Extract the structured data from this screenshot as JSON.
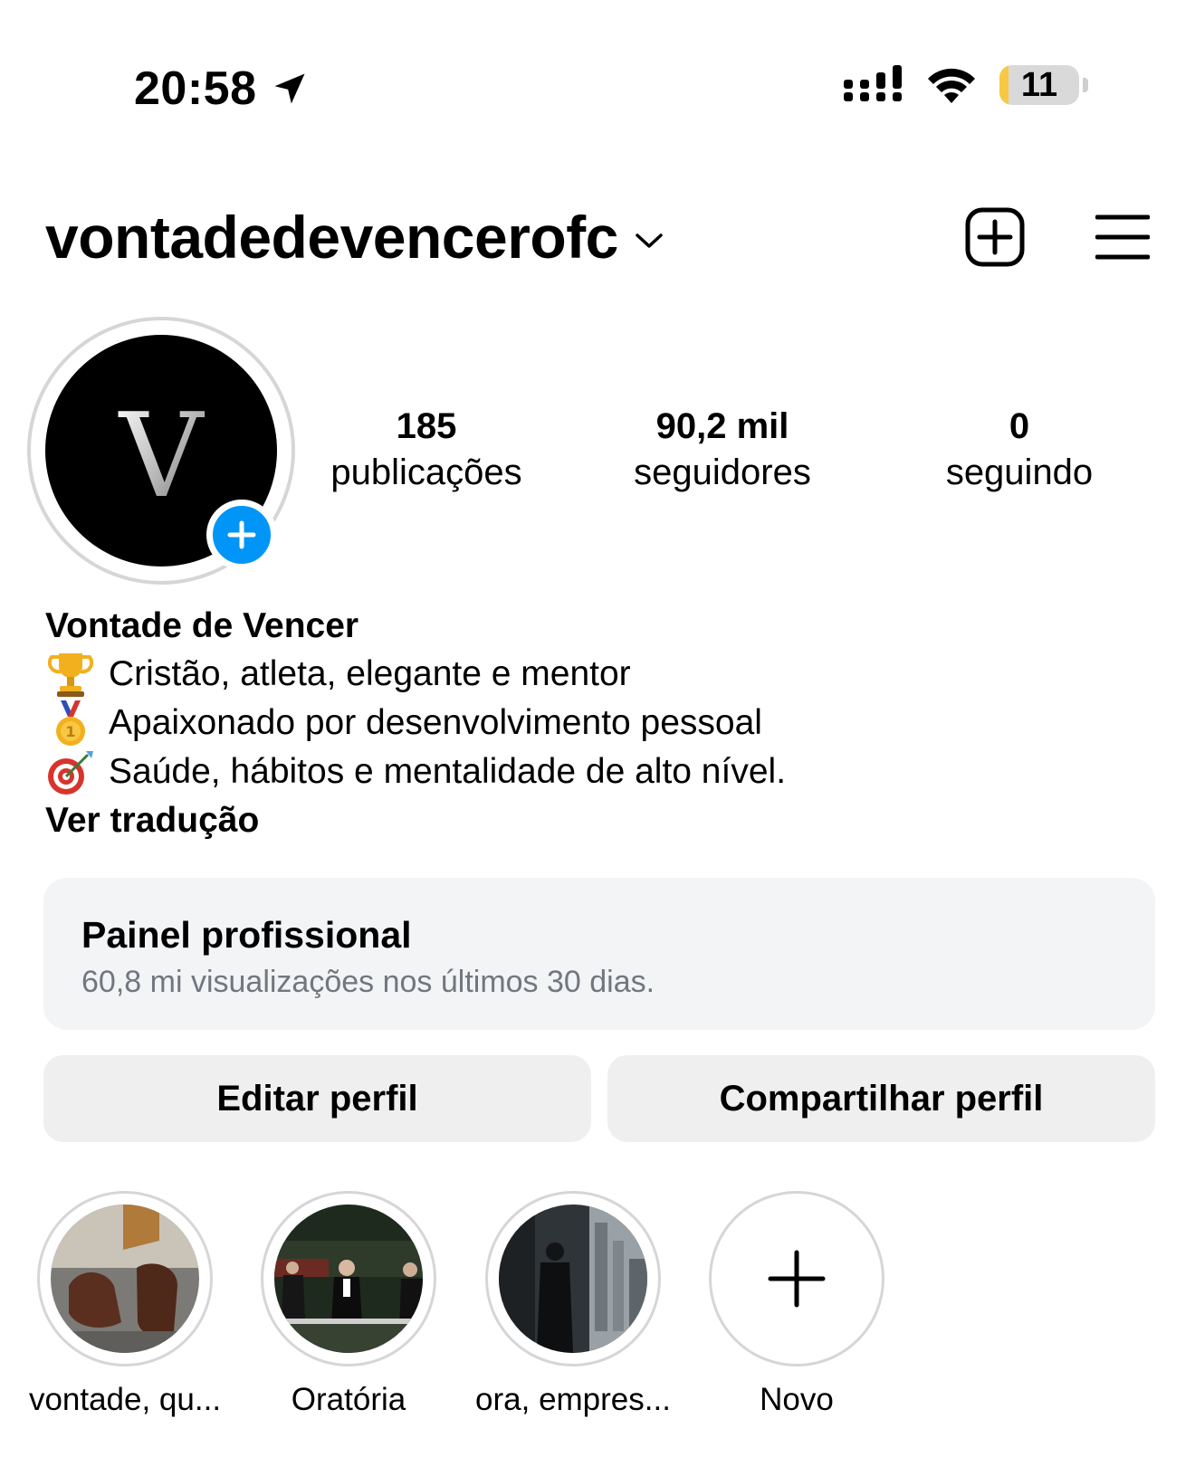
{
  "status_bar": {
    "time": "20:58",
    "battery_level": "11",
    "battery_fraction": 0.11,
    "icons": [
      "location-arrow-icon",
      "cellular-signal-icon",
      "wifi-icon",
      "battery-icon"
    ]
  },
  "header": {
    "username": "vontadedevencerofc",
    "icons": [
      "chevron-down-icon",
      "create-post-icon",
      "menu-icon"
    ]
  },
  "profile": {
    "avatar_letter": "V",
    "stats": [
      {
        "value": "185",
        "label": "publicações"
      },
      {
        "value": "90,2 mil",
        "label": "seguidores"
      },
      {
        "value": "0",
        "label": "seguindo"
      }
    ]
  },
  "bio": {
    "name": "Vontade de Vencer",
    "lines": [
      {
        "emoji": "trophy",
        "text": "Cristão, atleta, elegante e mentor"
      },
      {
        "emoji": "first-place-medal",
        "text": "Apaixonado por desenvolvimento pessoal"
      },
      {
        "emoji": "direct-hit",
        "text": "Saúde, hábitos e mentalidade de alto nível."
      }
    ],
    "translate_link": "Ver tradução"
  },
  "dashboard": {
    "title": "Painel profissional",
    "subtitle": "60,8 mi visualizações nos últimos 30 dias."
  },
  "buttons": {
    "edit": "Editar perfil",
    "share": "Compartilhar perfil"
  },
  "highlights": [
    {
      "label": "vontade, qu..."
    },
    {
      "label": "Oratória"
    },
    {
      "label": "ora, empres..."
    },
    {
      "label": "Novo"
    }
  ],
  "colors": {
    "accent_blue": "#0095f6",
    "battery_yellow": "#f7c843",
    "button_bg": "#efefef",
    "dashboard_bg": "#f3f4f6",
    "muted_text": "#72777f"
  }
}
